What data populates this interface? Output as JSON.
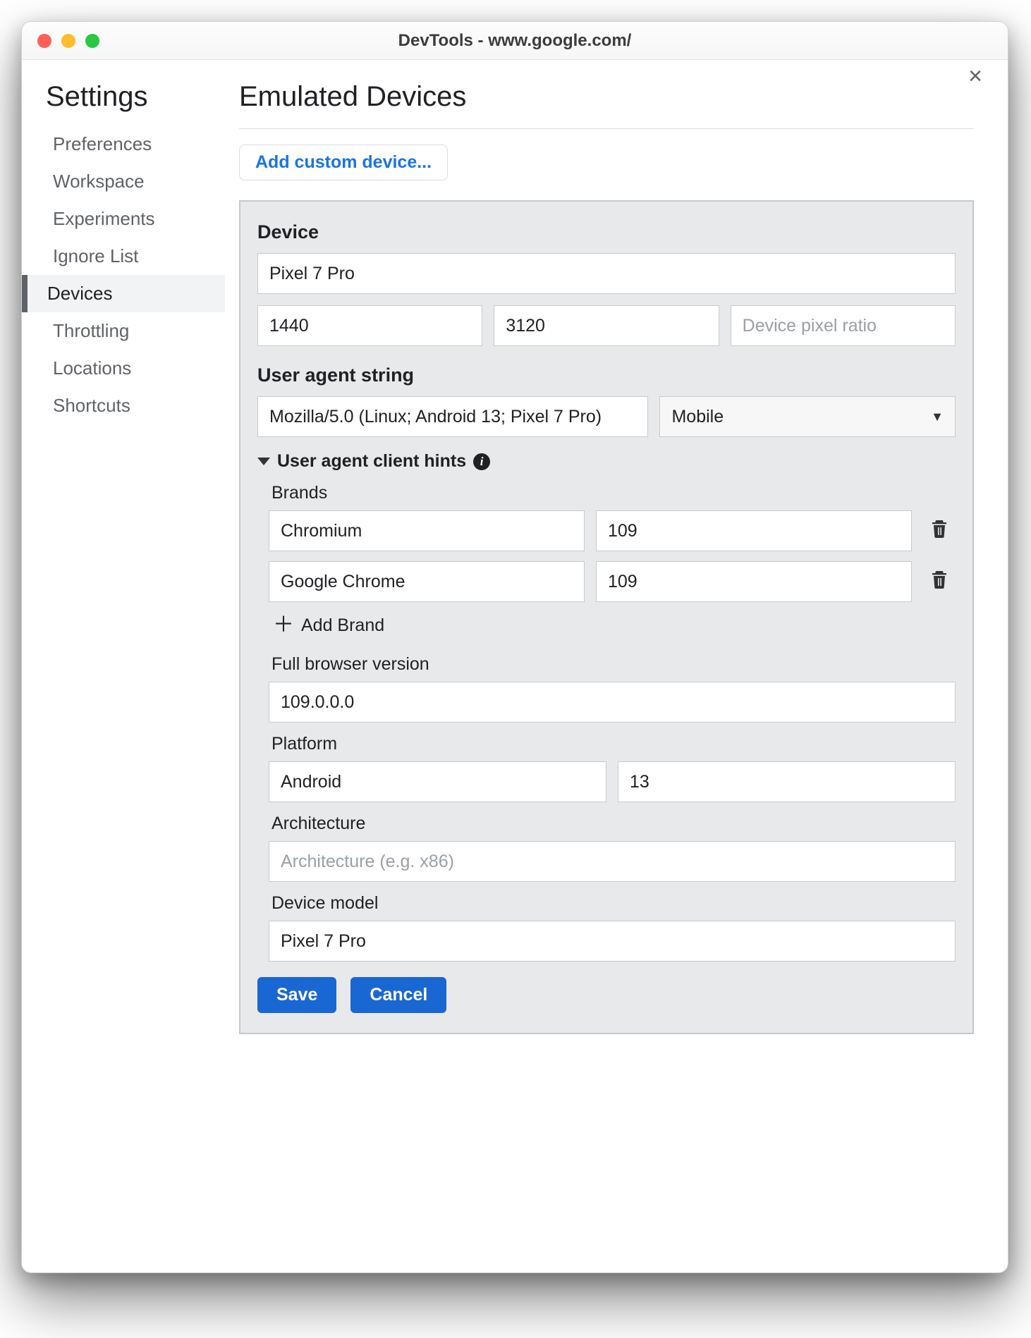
{
  "window": {
    "title": "DevTools - www.google.com/"
  },
  "sidebar": {
    "title": "Settings",
    "items": [
      "Preferences",
      "Workspace",
      "Experiments",
      "Ignore List",
      "Devices",
      "Throttling",
      "Locations",
      "Shortcuts"
    ],
    "selected_index": 4
  },
  "main": {
    "heading": "Emulated Devices",
    "add_custom_label": "Add custom device...",
    "device_section_label": "Device",
    "device_name": "Pixel 7 Pro",
    "width": "1440",
    "height": "3120",
    "dpr_placeholder": "Device pixel ratio",
    "ua_section_label": "User agent string",
    "ua_string": "Mozilla/5.0 (Linux; Android 13; Pixel 7 Pro)",
    "ua_type": "Mobile",
    "hints": {
      "disclosure_label": "User agent client hints",
      "brands_label": "Brands",
      "brands": [
        {
          "name": "Chromium",
          "version": "109"
        },
        {
          "name": "Google Chrome",
          "version": "109"
        }
      ],
      "add_brand_label": "Add Brand",
      "full_version_label": "Full browser version",
      "full_version": "109.0.0.0",
      "platform_label": "Platform",
      "platform_name": "Android",
      "platform_version": "13",
      "architecture_label": "Architecture",
      "architecture_placeholder": "Architecture (e.g. x86)",
      "model_label": "Device model",
      "model": "Pixel 7 Pro"
    },
    "save_label": "Save",
    "cancel_label": "Cancel"
  }
}
